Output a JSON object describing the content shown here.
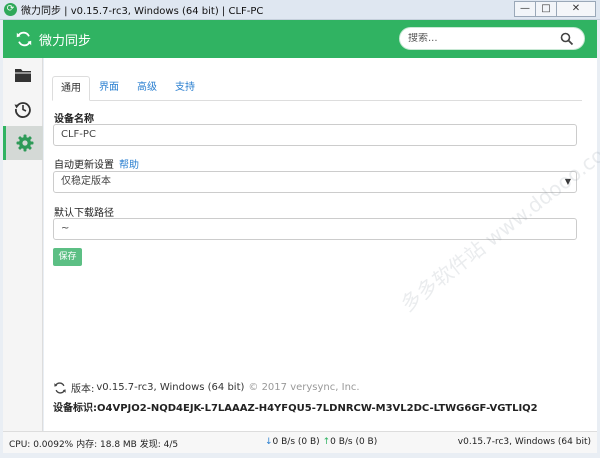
{
  "window": {
    "title": "微力同步 | v0.15.7-rc3, Windows (64 bit) | CLF-PC",
    "buttons": {
      "minimize": "—",
      "maximize": "□",
      "close": "✕"
    }
  },
  "header": {
    "brand": "微力同步",
    "search_placeholder": "搜索..."
  },
  "sidebar": {
    "items": [
      {
        "icon": "folder-icon",
        "label": "folders"
      },
      {
        "icon": "history-icon",
        "label": "history"
      },
      {
        "icon": "gear-icon",
        "label": "settings",
        "active": true
      }
    ]
  },
  "tabs": [
    {
      "label": "通用",
      "active": true
    },
    {
      "label": "界面"
    },
    {
      "label": "高级"
    },
    {
      "label": "支持"
    }
  ],
  "form": {
    "device_name_label": "设备名称",
    "device_name_value": "CLF-PC",
    "auto_update_label": "自动更新设置",
    "help_link": "帮助",
    "auto_update_value": "仅稳定版本",
    "download_path_label": "默认下载路径",
    "download_path_value": "~",
    "save_button": "保存"
  },
  "about": {
    "version_label": "版本:",
    "version_text": "v0.15.7-rc3, Windows (64 bit)",
    "copyright": "© 2017 verysync, Inc.",
    "device_id_label": "设备标识:",
    "device_id": "O4VPJO2-NQD4EJK-L7LAAAZ-H4YFQU5-7LDNRCW-M3VL2DC-LTWG6GF-VGTLIQ2"
  },
  "statusbar": {
    "cpu": "CPU: 0.0092%",
    "memory": "内存: 18.8 MB",
    "discovery": "发现: 4/5",
    "down_arrow": "↓",
    "down": "0 B/s (0 B)",
    "up_arrow": "↑",
    "up": "0 B/s (0 B)",
    "version": "v0.15.7-rc3, Windows (64 bit)"
  },
  "watermark": "多多软件站  www.ddooo.com",
  "colors": {
    "accent": "#30b362",
    "link": "#2a7fd0",
    "save": "#5cbf84"
  }
}
